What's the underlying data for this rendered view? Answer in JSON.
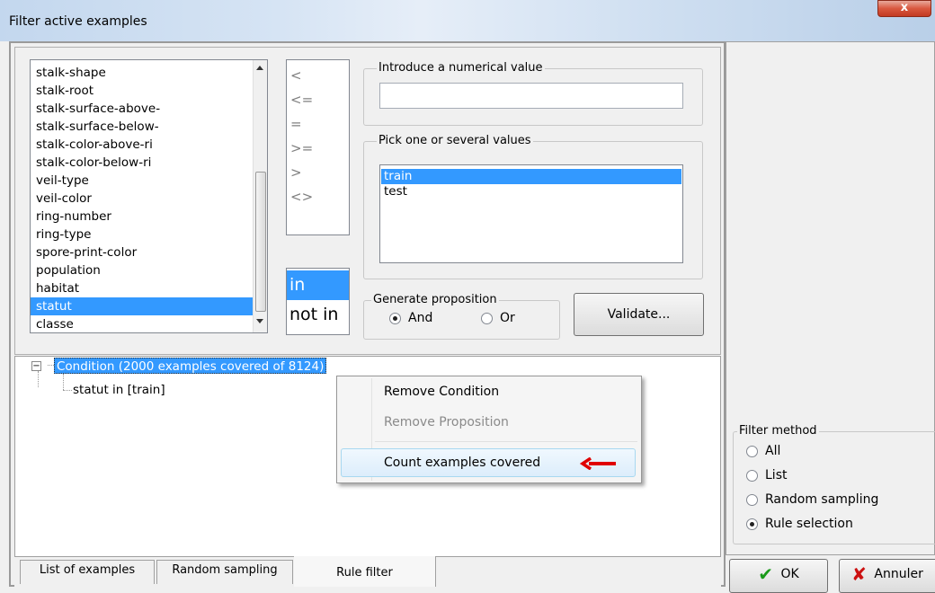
{
  "window": {
    "title": "Filter active examples",
    "close_label": "x"
  },
  "attributes": {
    "items": [
      "stalk-shape",
      "stalk-root",
      "stalk-surface-above-",
      "stalk-surface-below-",
      "stalk-color-above-ri",
      "stalk-color-below-ri",
      "veil-type",
      "veil-color",
      "ring-number",
      "ring-type",
      "spore-print-color",
      "population",
      "habitat",
      "statut",
      "classe"
    ],
    "selected": "statut"
  },
  "operators": {
    "items": [
      "<",
      "<=",
      "=",
      ">=",
      ">",
      "<>"
    ]
  },
  "set_ops": {
    "items": [
      "in",
      "not in"
    ],
    "selected": "in"
  },
  "numeric": {
    "title": "Introduce a numerical value",
    "value": ""
  },
  "values_box": {
    "title": "Pick one or several values",
    "items": [
      "train",
      "test"
    ],
    "selected": "train"
  },
  "generate": {
    "title": "Generate proposition",
    "and_label": "And",
    "or_label": "Or",
    "selected": "And"
  },
  "validate_label": "Validate...",
  "tree": {
    "root": "Condition (2000 examples covered of 8124)",
    "child": "statut in [train]",
    "expander": "⊟"
  },
  "context_menu": {
    "items": [
      {
        "label": "Remove Condition",
        "enabled": true
      },
      {
        "label": "Remove Proposition",
        "enabled": false
      },
      {
        "label": "Count examples covered",
        "enabled": true,
        "highlighted": true
      }
    ],
    "annotation_arrow_color": "#e00000"
  },
  "filter_method": {
    "title": "Filter method",
    "options": [
      "All",
      "List",
      "Random sampling",
      "Rule selection"
    ],
    "selected": "Rule selection"
  },
  "tabs": [
    "List of examples",
    "Random sampling",
    "Rule filter"
  ],
  "active_tab": "Rule filter",
  "buttons": {
    "ok_label": "OK",
    "cancel_label": "Annuler"
  },
  "colors": {
    "selection": "#3399ff",
    "ok_check": "#1a9a1a",
    "cancel_x": "#cc1111"
  }
}
